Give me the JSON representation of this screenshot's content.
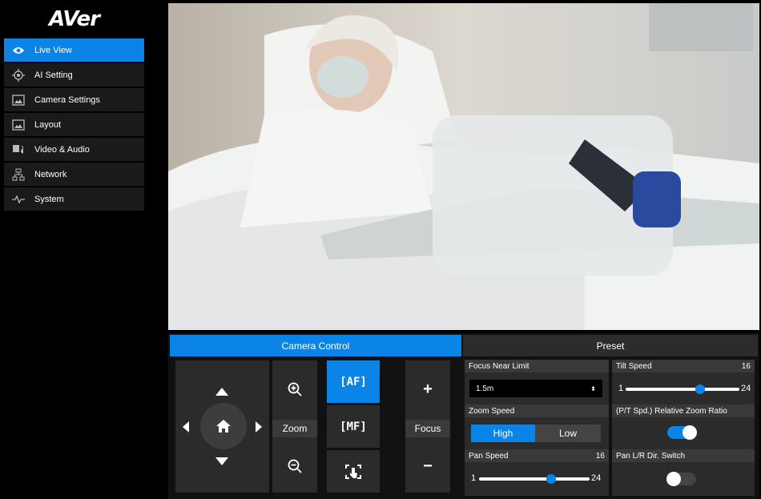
{
  "brand": {
    "logo": "AVer"
  },
  "sidebar": {
    "items": [
      {
        "label": "Live View",
        "icon": "eye-icon",
        "active": true
      },
      {
        "label": "AI Setting",
        "icon": "target-icon",
        "active": false
      },
      {
        "label": "Camera Settings",
        "icon": "image-icon",
        "active": false
      },
      {
        "label": "Layout",
        "icon": "layout-icon",
        "active": false
      },
      {
        "label": "Video & Audio",
        "icon": "video-audio-icon",
        "active": false
      },
      {
        "label": "Network",
        "icon": "network-icon",
        "active": false
      },
      {
        "label": "System",
        "icon": "pulse-icon",
        "active": false
      }
    ]
  },
  "tabs": {
    "camera_control": "Camera Control",
    "preset": "Preset"
  },
  "camera_control": {
    "zoom_label": "Zoom",
    "focus_label": "Focus",
    "af_label": "AF",
    "mf_label": "MF",
    "focus_plus": "+",
    "focus_minus": "−"
  },
  "settings": {
    "focus_near_limit": {
      "label": "Focus Near Limit",
      "value": "1.5m"
    },
    "tilt_speed": {
      "label": "Tilt Speed",
      "value": "16",
      "min": "1",
      "max": "24",
      "level": 16
    },
    "zoom_speed": {
      "label": "Zoom Speed",
      "options": [
        "High",
        "Low"
      ],
      "selected": "High"
    },
    "relative_zoom_ratio": {
      "label": "(P/T Spd.) Relative Zoom Ratio",
      "enabled": true
    },
    "pan_speed": {
      "label": "Pan Speed",
      "value": "16",
      "min": "1",
      "max": "24",
      "level": 16
    },
    "pan_dir_switch": {
      "label": "Pan L/R Dir. Switch",
      "enabled": false
    }
  },
  "colors": {
    "accent": "#0a84e6",
    "sidebar_item": "#1a1a1a",
    "panel": "#2b2b2b"
  }
}
